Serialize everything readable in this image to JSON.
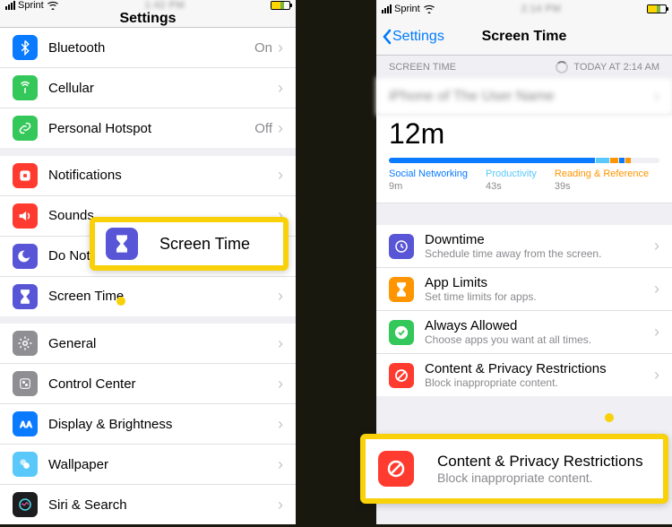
{
  "left": {
    "status": {
      "carrier": "Sprint",
      "time_blur": "1:42 PM"
    },
    "title": "Settings",
    "rows1": [
      {
        "label": "Bluetooth",
        "value": "On",
        "iconColor": "#0a7aff",
        "icon": "bluetooth"
      },
      {
        "label": "Cellular",
        "value": "",
        "iconColor": "#34c759",
        "icon": "antenna"
      },
      {
        "label": "Personal Hotspot",
        "value": "Off",
        "iconColor": "#34c759",
        "icon": "link"
      }
    ],
    "rows2": [
      {
        "label": "Notifications",
        "iconColor": "#ff3b30",
        "icon": "bell"
      },
      {
        "label": "Sounds",
        "iconColor": "#ff3b30",
        "icon": "sound"
      },
      {
        "label": "Do Not Disturb",
        "iconColor": "#5856d6",
        "icon": "moon",
        "truncated": "Do Not"
      },
      {
        "label": "Screen Time",
        "iconColor": "#5856d6",
        "icon": "hourglass"
      }
    ],
    "rows3": [
      {
        "label": "General",
        "iconColor": "#8e8e93",
        "icon": "gear"
      },
      {
        "label": "Control Center",
        "iconColor": "#8e8e93",
        "icon": "sliders"
      },
      {
        "label": "Display & Brightness",
        "iconColor": "#0a7aff",
        "icon": "brightness"
      },
      {
        "label": "Wallpaper",
        "iconColor": "#5ac8fa",
        "icon": "wallpaper"
      },
      {
        "label": "Siri & Search",
        "iconColor": "#1d1d1f",
        "icon": "siri"
      }
    ],
    "callout": {
      "label": "Screen Time"
    }
  },
  "right": {
    "status": {
      "carrier": "Sprint",
      "time_blur": "2:14 PM"
    },
    "back": "Settings",
    "title": "Screen Time",
    "section_label": "SCREEN TIME",
    "updated": "Today at 2:14 AM",
    "device_blur": "iPhone of The User Name",
    "total": "12m",
    "bar_segments": [
      {
        "color": "#0a7aff",
        "width": "76%"
      },
      {
        "color": "#5ac8fa",
        "width": "5%"
      },
      {
        "color": "#ff9500",
        "width": "3%"
      },
      {
        "color": "#0a7aff",
        "width": "2%"
      },
      {
        "color": "#ff9500",
        "width": "2%"
      }
    ],
    "legend": [
      {
        "label": "Social Networking",
        "color": "#0a7aff",
        "value": "9m"
      },
      {
        "label": "Productivity",
        "color": "#5ac8fa",
        "value": "43s"
      },
      {
        "label": "Reading & Reference",
        "color": "#ff9500",
        "value": "39s"
      }
    ],
    "options": [
      {
        "title": "Downtime",
        "sub": "Schedule time away from the screen.",
        "iconColor": "#5856d6",
        "icon": "downtime"
      },
      {
        "title": "App Limits",
        "sub": "Set time limits for apps.",
        "iconColor": "#ff9500",
        "icon": "hourglass"
      },
      {
        "title": "Always Allowed",
        "sub": "Choose apps you want at all times.",
        "iconColor": "#34c759",
        "icon": "check"
      },
      {
        "title": "Content & Privacy Restrictions",
        "sub": "Block inappropriate content.",
        "iconColor": "#ff3b30",
        "icon": "nosign"
      }
    ],
    "callout": {
      "title": "Content & Privacy Restrictions",
      "sub": "Block inappropriate content."
    }
  }
}
